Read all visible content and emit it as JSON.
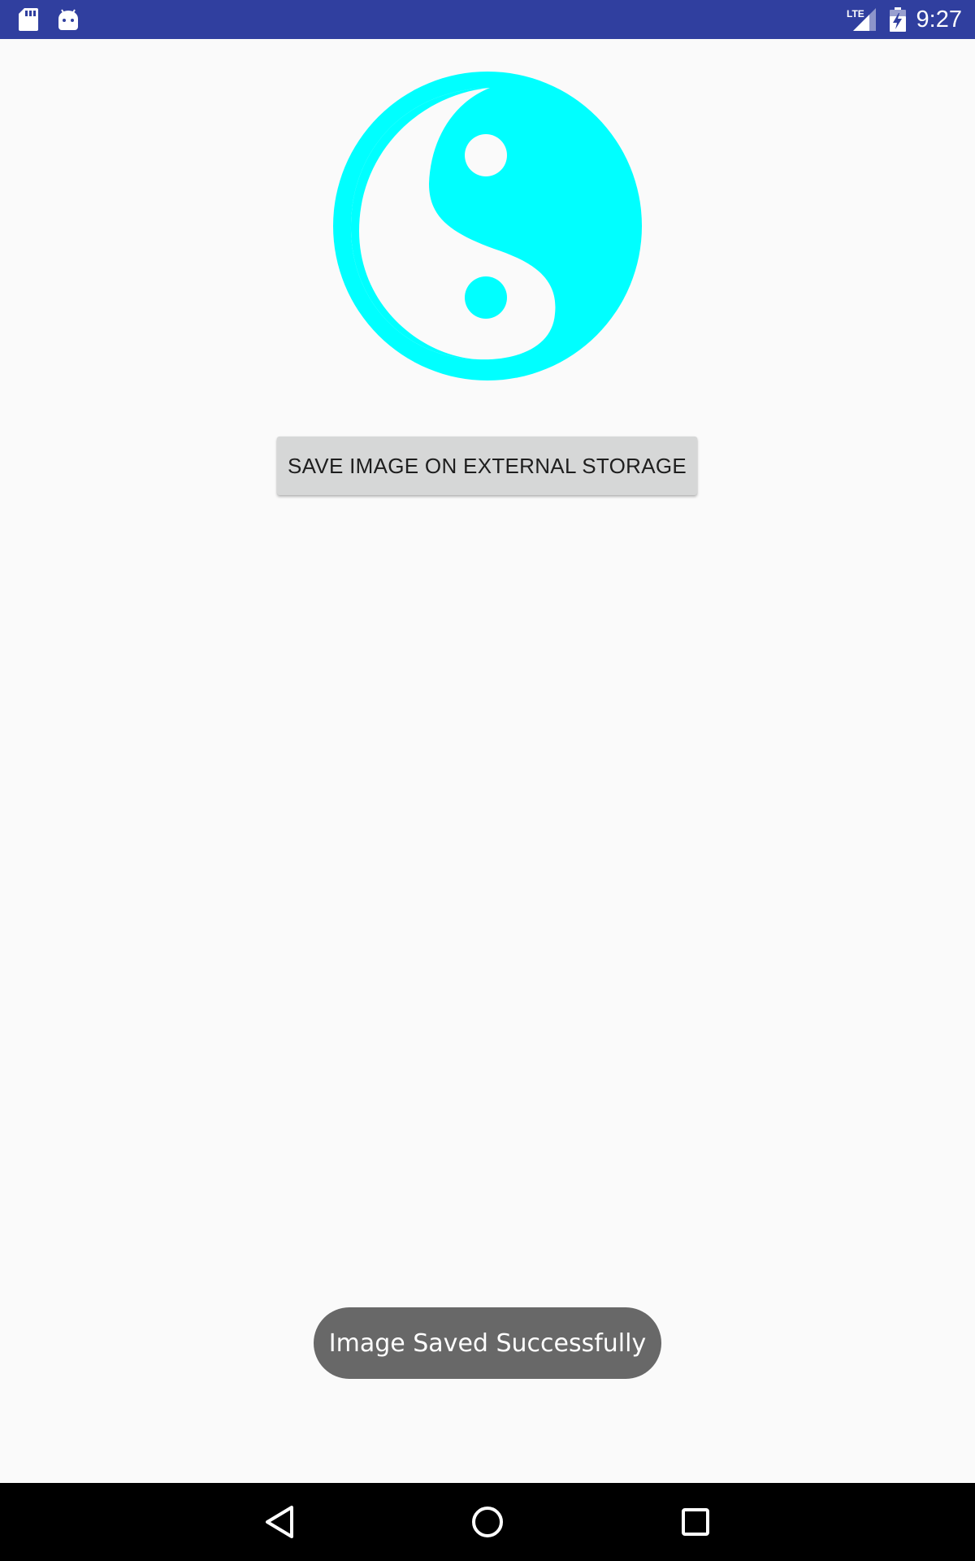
{
  "status_bar": {
    "time": "9:27",
    "network": "LTE",
    "icons": [
      "sd-card-icon",
      "android-debug-icon",
      "lte-signal-icon",
      "battery-charging-icon"
    ],
    "background": "#303f9f"
  },
  "main": {
    "image": {
      "icon": "yin-yang-icon",
      "color": "#00ffff"
    },
    "save_button_label": "SAVE IMAGE ON EXTERNAL STORAGE"
  },
  "toast": {
    "message": "Image Saved Successfully"
  },
  "nav_bar": {
    "buttons": [
      "back-icon",
      "home-icon",
      "recents-icon"
    ]
  }
}
